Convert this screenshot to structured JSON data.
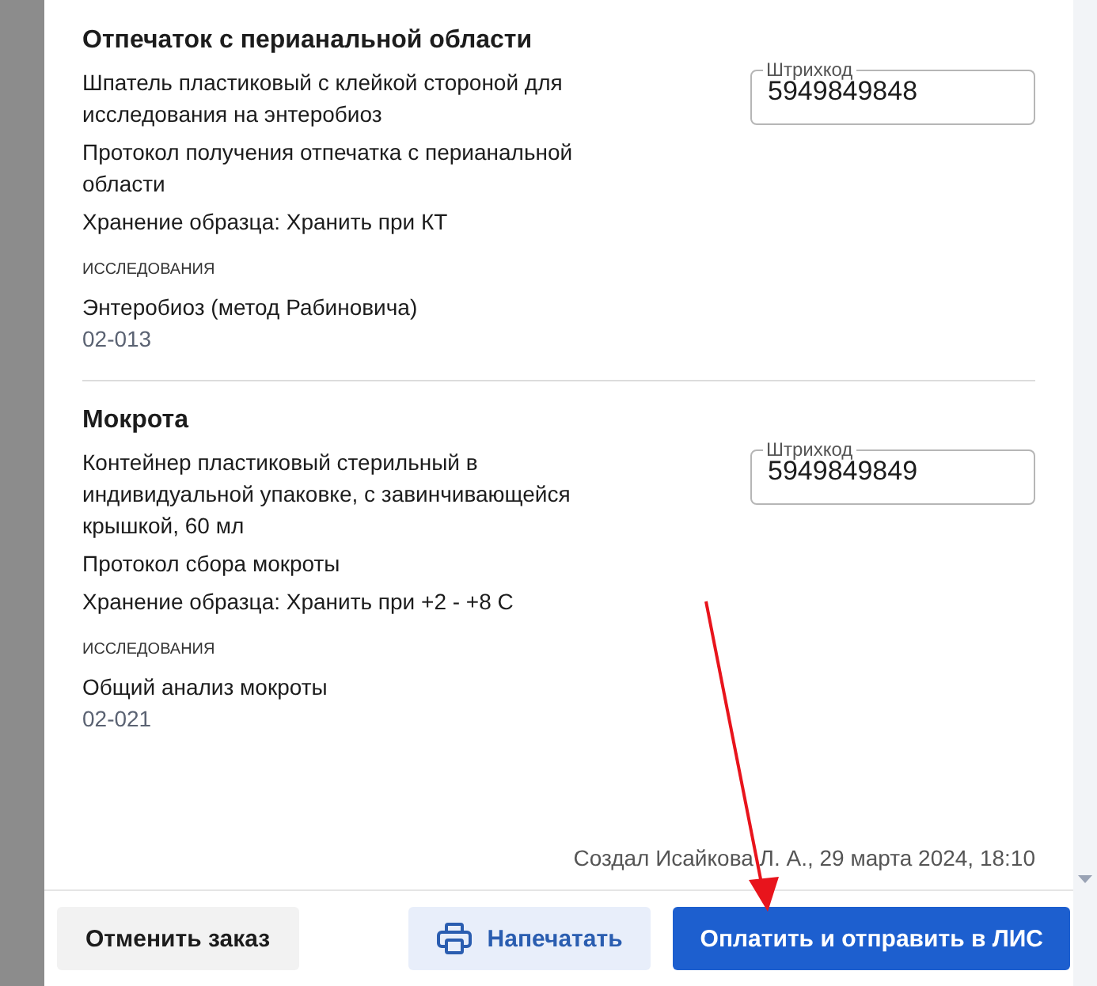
{
  "samples": [
    {
      "title": "Отпечаток с перианальной области",
      "lines": [
        "Шпатель пластиковый с клейкой стороной для исследования на энтеробиоз",
        "Протокол получения отпечатка с перианальной области",
        "Хранение образца: Хранить при КТ"
      ],
      "barcode": {
        "label": "Штрихкод",
        "value": "5949849848"
      },
      "studies_label": "ИССЛЕДОВАНИЯ",
      "studies": [
        {
          "name": "Энтеробиоз (метод Рабиновича)",
          "code": "02-013"
        }
      ]
    },
    {
      "title": "Мокрота",
      "lines": [
        "Контейнер пластиковый стерильный в индивидуальной упаковке, с завинчивающейся крышкой, 60 мл",
        "Протокол сбора мокроты",
        "Хранение образца: Хранить при +2 - +8 С"
      ],
      "barcode": {
        "label": "Штрихкод",
        "value": "5949849849"
      },
      "studies_label": "ИССЛЕДОВАНИЯ",
      "studies": [
        {
          "name": "Общий анализ мокроты",
          "code": "02-021"
        }
      ]
    }
  ],
  "footer_note": "Создал Исайкова Л. А., 29 марта 2024, 18:10",
  "buttons": [
    {
      "label": "Отменить заказ",
      "kind": "secondary"
    },
    {
      "label": "Напечатать",
      "kind": "print"
    },
    {
      "label": "Оплатить и отправить в ЛИС",
      "kind": "primary"
    }
  ]
}
